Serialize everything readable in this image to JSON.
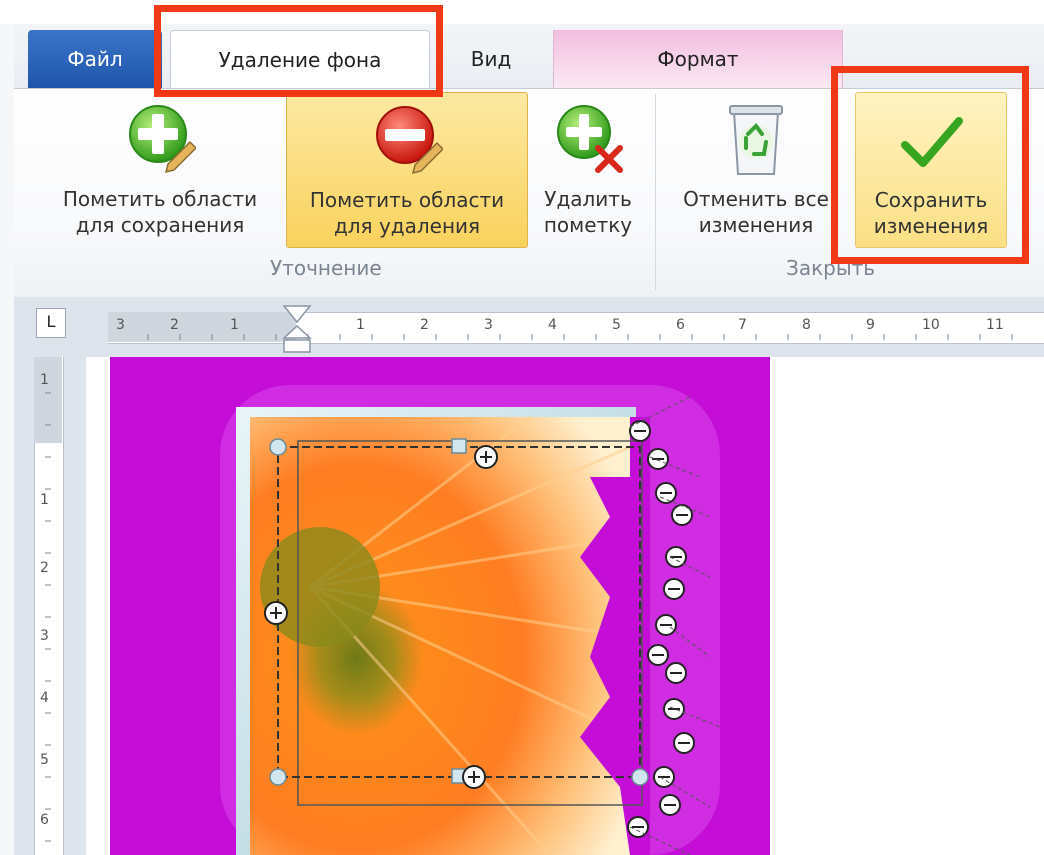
{
  "tabs": {
    "file": "Файл",
    "background_removal": "Удаление фона",
    "view": "Вид",
    "format": "Формат"
  },
  "ribbon": {
    "refine_group": {
      "label": "Уточнение",
      "mark_keep": {
        "line1": "Пометить области",
        "line2": "для сохранения"
      },
      "mark_remove": {
        "line1": "Пометить области",
        "line2": "для удаления"
      },
      "delete_mark": {
        "line1": "Удалить",
        "line2": "пометку"
      }
    },
    "close_group": {
      "label": "Закрыть",
      "discard": {
        "line1": "Отменить все",
        "line2": "изменения"
      },
      "save": {
        "line1": "Сохранить",
        "line2": "изменения"
      }
    }
  },
  "ruler": {
    "tab_selector": "L",
    "horizontal_labels": [
      "3",
      "2",
      "1",
      "1",
      "2",
      "3",
      "4",
      "5",
      "6",
      "7",
      "8",
      "9",
      "10",
      "11"
    ],
    "vertical_labels": [
      "1",
      "1",
      "2",
      "3",
      "4",
      "5",
      "6"
    ]
  },
  "colors": {
    "highlight": "#f03a17",
    "file_tab": "#2a64bb",
    "picture_background": "#c40dd6"
  }
}
